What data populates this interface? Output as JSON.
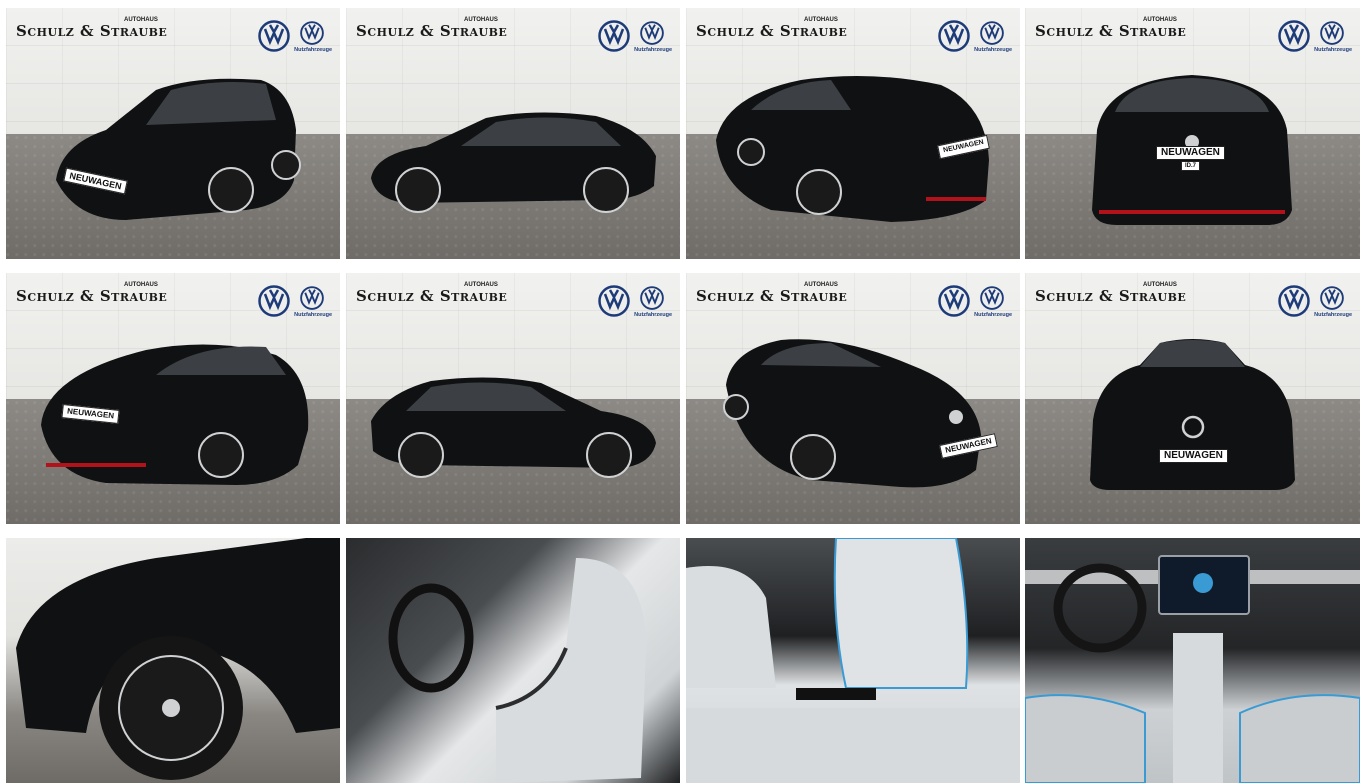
{
  "gallery": {
    "dealer": {
      "name": "Schulz & Straube",
      "tagline": "AUTOHAUS",
      "brand_sub": "Nutzfahrzeuge"
    },
    "badge": "NEUWAGEN",
    "tiles": [
      {
        "view": "front-left-3quarter",
        "has_plate": true
      },
      {
        "view": "left-side"
      },
      {
        "view": "rear-right-3quarter",
        "has_plate": true
      },
      {
        "view": "rear",
        "has_plate": true,
        "model_badge": "ID.7"
      },
      {
        "view": "rear-left-3quarter",
        "has_plate": true
      },
      {
        "view": "right-side"
      },
      {
        "view": "front-right-3quarter",
        "has_plate": true
      },
      {
        "view": "front",
        "has_plate": true
      },
      {
        "view": "wheel-detail"
      },
      {
        "view": "front-seats-interior"
      },
      {
        "view": "rear-seats-interior"
      },
      {
        "view": "cockpit-dashboard"
      }
    ],
    "colors": {
      "car_black": "#101112",
      "vw_blue": "#1d3b78",
      "accent_red": "#b3121b",
      "interior_light": "#d8dcdf",
      "interior_accent": "#3a9bd4"
    }
  }
}
